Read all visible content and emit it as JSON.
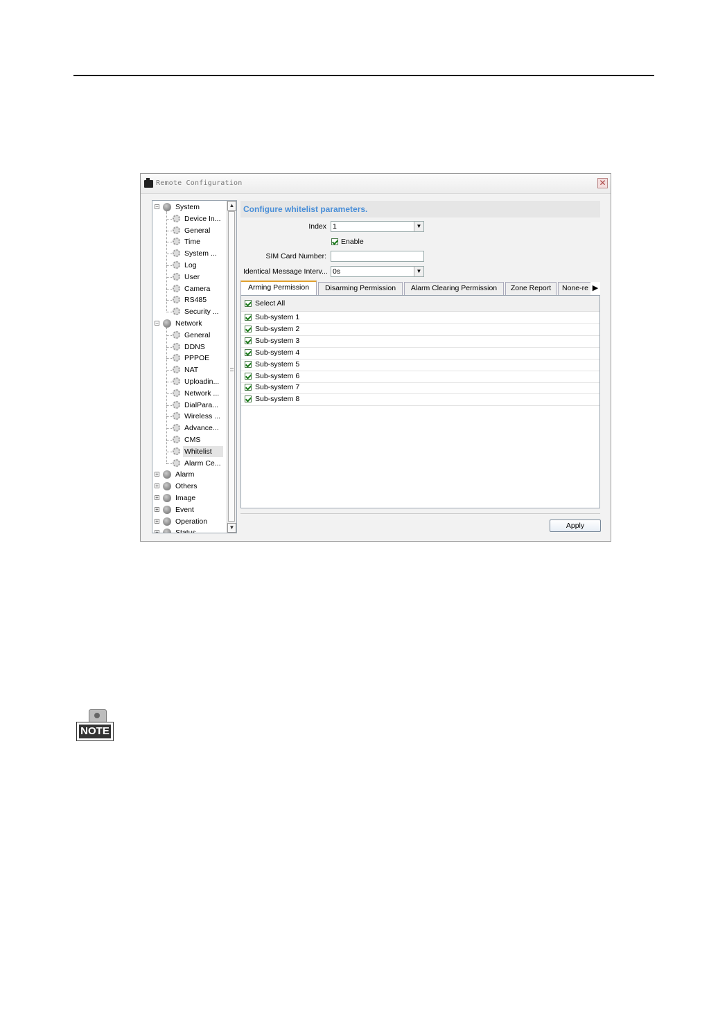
{
  "window": {
    "title": "Remote Configuration",
    "close_glyph": "✕"
  },
  "tree": {
    "groups": [
      {
        "label": "System",
        "expanded": true,
        "children": [
          "Device In...",
          "General",
          "Time",
          "System ...",
          "Log",
          "User",
          "Camera",
          "RS485",
          "Security ..."
        ]
      },
      {
        "label": "Network",
        "expanded": true,
        "children": [
          "General",
          "DDNS",
          "PPPOE",
          "NAT",
          "Uploadin...",
          "Network ...",
          "DialPara...",
          "Wireless ...",
          "Advance...",
          "CMS",
          "Whitelist",
          "Alarm Ce..."
        ]
      },
      {
        "label": "Alarm",
        "expanded": false
      },
      {
        "label": "Others",
        "expanded": false
      },
      {
        "label": "Image",
        "expanded": false
      },
      {
        "label": "Event",
        "expanded": false
      },
      {
        "label": "Operation",
        "expanded": false
      },
      {
        "label": "Status",
        "expanded": false
      }
    ],
    "selected": "Whitelist"
  },
  "main": {
    "header": "Configure whitelist parameters.",
    "index_label": "Index",
    "index_value": "1",
    "enable_label": "Enable",
    "enable_checked": true,
    "sim_label": "SIM Card Number:",
    "sim_value": "",
    "interval_label": "Identical Message Interv...",
    "interval_value": "0s"
  },
  "tabs": [
    "Arming Permission",
    "Disarming Permission",
    "Alarm Clearing Permission",
    "Zone Report",
    "None-re"
  ],
  "active_tab": "Arming Permission",
  "permission_list": {
    "select_all_label": "Select All",
    "items": [
      "Sub-system 1",
      "Sub-system 2",
      "Sub-system 3",
      "Sub-system 4",
      "Sub-system 5",
      "Sub-system 6",
      "Sub-system 7",
      "Sub-system 8"
    ]
  },
  "apply_label": "Apply",
  "note": {
    "label": "NOTE"
  }
}
